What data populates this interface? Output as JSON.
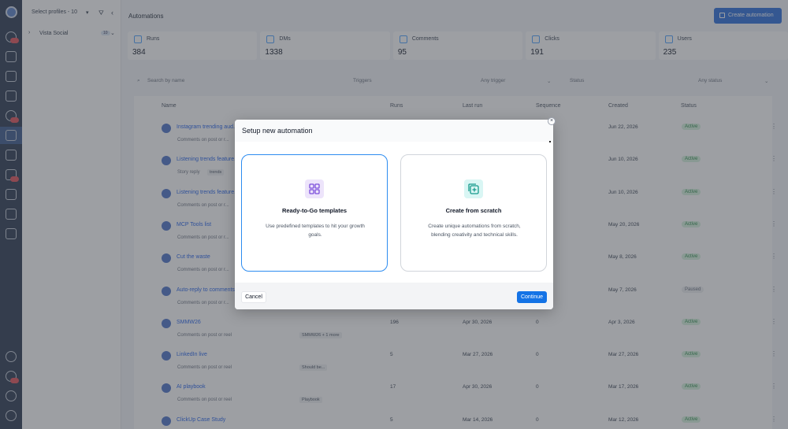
{
  "sidebar": {
    "profile_select": "Select profiles - 10",
    "profile_name": "Vista Social",
    "profile_count": "10"
  },
  "header": {
    "title": "Automations",
    "create_button": "Create automation"
  },
  "stats": [
    {
      "label": "Runs",
      "value": "384"
    },
    {
      "label": "DMs",
      "value": "1338"
    },
    {
      "label": "Comments",
      "value": "95"
    },
    {
      "label": "Clicks",
      "value": "191"
    },
    {
      "label": "Users",
      "value": "235"
    }
  ],
  "filters": {
    "search_placeholder": "Search by name",
    "triggers_label": "Triggers",
    "triggers_value": "Any trigger",
    "status_label": "Status",
    "status_value": "Any status"
  },
  "table": {
    "columns": [
      "Name",
      "Runs",
      "Last run",
      "Sequence",
      "Created",
      "Status"
    ],
    "rows": [
      {
        "name": "Instagram trending aud...",
        "sub": "Comments on post or r...",
        "tag": "",
        "runs": "",
        "last_run": "",
        "sequence": "",
        "created": "Jun 22, 2026",
        "status": "Active"
      },
      {
        "name": "Listening trends feature...",
        "sub": "Story reply",
        "tag": "trends",
        "runs": "",
        "last_run": "",
        "sequence": "",
        "created": "Jun 10, 2026",
        "status": "Active"
      },
      {
        "name": "Listening trends feature...",
        "sub": "Comments on post or r...",
        "tag": "",
        "runs": "",
        "last_run": "",
        "sequence": "",
        "created": "Jun 10, 2026",
        "status": "Active"
      },
      {
        "name": "MCP Tools list",
        "sub": "Comments on post or r...",
        "tag": "",
        "runs": "",
        "last_run": "",
        "sequence": "",
        "created": "May 20, 2026",
        "status": "Active"
      },
      {
        "name": "Cut the waste",
        "sub": "Comments on post or r...",
        "tag": "",
        "runs": "",
        "last_run": "",
        "sequence": "",
        "created": "May 8, 2026",
        "status": "Active"
      },
      {
        "name": "Auto-reply to comments",
        "sub": "Comments on post or r...",
        "tag": "",
        "runs": "",
        "last_run": "",
        "sequence": "",
        "created": "May 7, 2026",
        "status": "Paused"
      },
      {
        "name": "SMMW26",
        "sub": "Comments on post or reel",
        "tag": "SMMW26 + 1 more",
        "runs": "196",
        "last_run": "Apr 30, 2026",
        "sequence": "0",
        "created": "Apr 3, 2026",
        "status": "Active"
      },
      {
        "name": "LinkedIn live",
        "sub": "Comments on post or reel",
        "tag": "Should be...",
        "runs": "5",
        "last_run": "Mar 27, 2026",
        "sequence": "0",
        "created": "Mar 27, 2026",
        "status": "Active"
      },
      {
        "name": "AI playbook",
        "sub": "Comments on post or reel",
        "tag": "Playbook",
        "runs": "17",
        "last_run": "Apr 30, 2026",
        "sequence": "0",
        "created": "Mar 17, 2026",
        "status": "Active"
      },
      {
        "name": "ClickUp Case Study",
        "sub": "",
        "tag": "",
        "runs": "5",
        "last_run": "Mar 14, 2026",
        "sequence": "0",
        "created": "Mar 12, 2026",
        "status": "Active"
      }
    ]
  },
  "modal": {
    "title": "Setup new automation",
    "option_templates": {
      "title": "Ready-to-Go templates",
      "description": "Use predefined templates to hit your growth goals."
    },
    "option_scratch": {
      "title": "Create from scratch",
      "description": "Create unique automations from scratch, blending creativity and technical skills."
    },
    "cancel_label": "Cancel",
    "continue_label": "Continue"
  },
  "colors": {
    "accent": "#1473e6",
    "sidebar_bg": "#2d3b53",
    "active_status": "#2f8f4e"
  }
}
